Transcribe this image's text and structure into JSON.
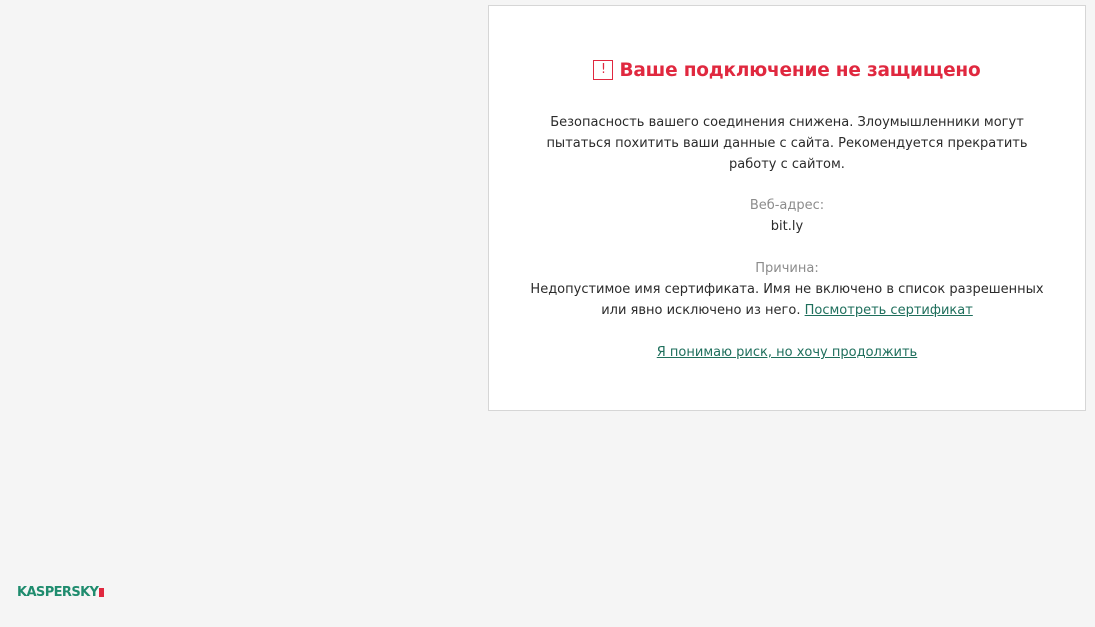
{
  "warning": {
    "icon": "exclamation-icon",
    "icon_glyph": "!",
    "title": "Ваше подключение не защищено",
    "description": "Безопасность вашего соединения снижена. Злоумышленники могут пытаться похитить ваши данные с сайта. Рекомендуется прекратить работу с сайтом.",
    "url_label": "Веб-адрес:",
    "url_value": "bit.ly",
    "reason_label": "Причина:",
    "reason_text": "Недопустимое имя сертификата. Имя не включено в список разрешенных или явно исключено из него.",
    "view_certificate_link": "Посмотреть сертификат",
    "proceed_link": "Я понимаю риск, но хочу продолжить"
  },
  "branding": {
    "logo_text": "KASPERSKY"
  },
  "colors": {
    "alert": "#e0283f",
    "link": "#1f6f5c",
    "brand": "#1f8c6e",
    "background": "#f5f5f5"
  }
}
